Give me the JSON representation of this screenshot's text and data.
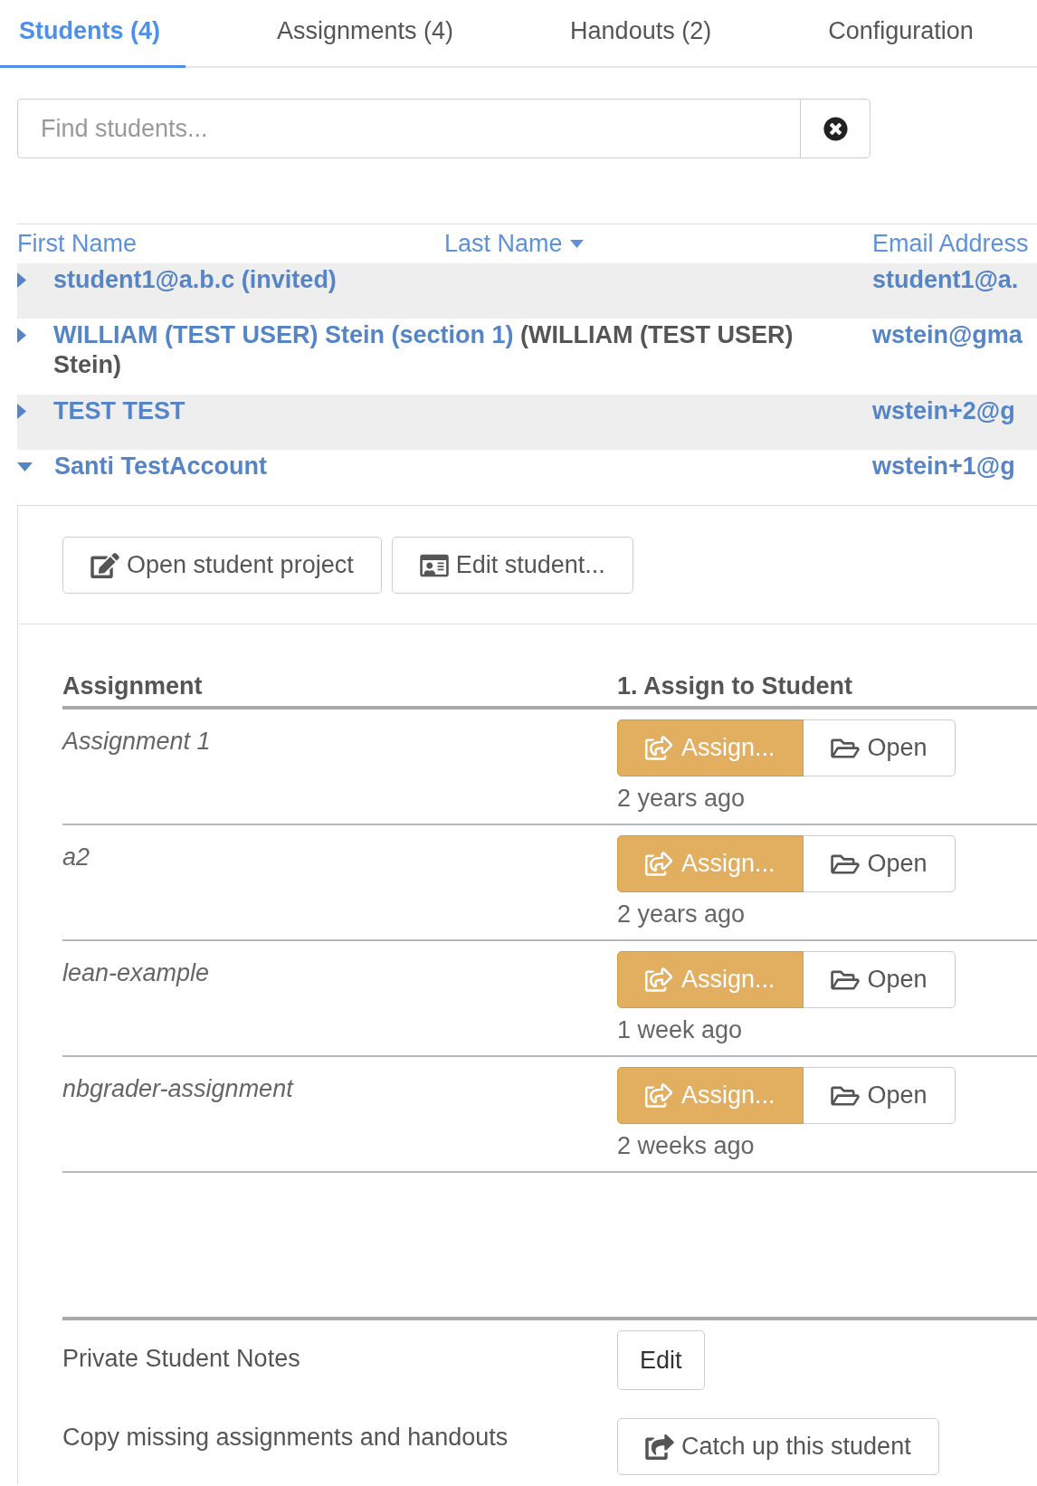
{
  "tabs": [
    {
      "label": "Students (4)",
      "selected": true
    },
    {
      "label": "Assignments (4)",
      "selected": false
    },
    {
      "label": "Handouts (2)",
      "selected": false
    },
    {
      "label": "Configuration",
      "selected": false
    }
  ],
  "search": {
    "placeholder": "Find students..."
  },
  "students": {
    "columns": [
      {
        "label": "First Name",
        "sorted": false
      },
      {
        "label": "Last Name",
        "sorted": true
      },
      {
        "label": "Email Address",
        "sorted": false
      }
    ],
    "rows": [
      {
        "name": "student1@a.b.c (invited)",
        "email": "student1@a.",
        "expanded": false
      },
      {
        "name": "WILLIAM (TEST USER) Stein (section 1)",
        "account_name": "(WILLIAM (TEST USER) Stein)",
        "email": "wstein@gma",
        "expanded": false
      },
      {
        "name": "TEST TEST",
        "email": "wstein+2@g",
        "expanded": false
      },
      {
        "name": "Santi TestAccount",
        "email": "wstein+1@g",
        "expanded": true
      }
    ]
  },
  "student_details": {
    "buttons": [
      "Open student project",
      "Edit student..."
    ],
    "assignments": {
      "columns": [
        "Assignment",
        "1. Assign to Student"
      ],
      "rows": [
        {
          "name": "Assignment 1",
          "assign": "Assign...",
          "open": "Open",
          "time": "2 years ago"
        },
        {
          "name": "a2",
          "assign": "Assign...",
          "open": "Open",
          "time": "2 years ago"
        },
        {
          "name": "lean-example",
          "assign": "Assign...",
          "open": "Open",
          "time": "1 week ago"
        },
        {
          "name": "nbgrader-assignment",
          "assign": "Assign...",
          "open": "Open",
          "time": "2 weeks ago"
        }
      ]
    },
    "notes": {
      "label": "Private Student Notes",
      "button": "Edit"
    },
    "catch_up": {
      "label": "Copy missing assignments and handouts",
      "button": "Catch up this student"
    }
  }
}
